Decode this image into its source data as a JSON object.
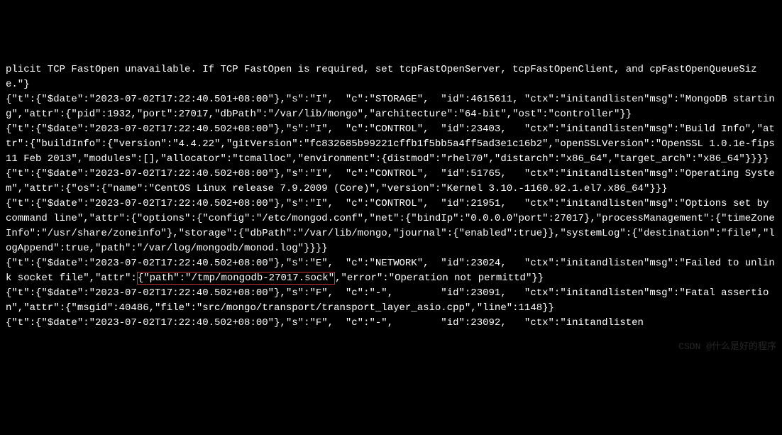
{
  "lines": {
    "line0": "plicit TCP FastOpen unavailable. If TCP FastOpen is required, set tcpFastOpenServer, tcpFastOpenClient, and cpFastOpenQueueSize.\"}",
    "line1": "{\"t\":{\"$date\":\"2023-07-02T17:22:40.501+08:00\"},\"s\":\"I\",  \"c\":\"STORAGE\",  \"id\":4615611, \"ctx\":\"initandlisten\"msg\":\"MongoDB starting\",\"attr\":{\"pid\":1932,\"port\":27017,\"dbPath\":\"/var/lib/mongo\",\"architecture\":\"64-bit\",\"ost\":\"controller\"}}",
    "line2": "{\"t\":{\"$date\":\"2023-07-02T17:22:40.502+08:00\"},\"s\":\"I\",  \"c\":\"CONTROL\",  \"id\":23403,   \"ctx\":\"initandlisten\"msg\":\"Build Info\",\"attr\":{\"buildInfo\":{\"version\":\"4.4.22\",\"gitVersion\":\"fc832685b99221cffb1f5bb5a4ff5ad3e1c16b2\",\"openSSLVersion\":\"OpenSSL 1.0.1e-fips 11 Feb 2013\",\"modules\":[],\"allocator\":\"tcmalloc\",\"environment\":{distmod\":\"rhel70\",\"distarch\":\"x86_64\",\"target_arch\":\"x86_64\"}}}}",
    "line3": "{\"t\":{\"$date\":\"2023-07-02T17:22:40.502+08:00\"},\"s\":\"I\",  \"c\":\"CONTROL\",  \"id\":51765,   \"ctx\":\"initandlisten\"msg\":\"Operating System\",\"attr\":{\"os\":{\"name\":\"CentOS Linux release 7.9.2009 (Core)\",\"version\":\"Kernel 3.10.-1160.92.1.el7.x86_64\"}}}",
    "line4": "{\"t\":{\"$date\":\"2023-07-02T17:22:40.502+08:00\"},\"s\":\"I\",  \"c\":\"CONTROL\",  \"id\":21951,   \"ctx\":\"initandlisten\"msg\":\"Options set by command line\",\"attr\":{\"options\":{\"config\":\"/etc/mongod.conf\",\"net\":{\"bindIp\":\"0.0.0.0\"port\":27017},\"processManagement\":{\"timeZoneInfo\":\"/usr/share/zoneinfo\"},\"storage\":{\"dbPath\":\"/var/lib/mongo,\"journal\":{\"enabled\":true}},\"systemLog\":{\"destination\":\"file\",\"logAppend\":true,\"path\":\"/var/log/mongodb/monod.log\"}}}}",
    "line5_pre": "{\"t\":{\"$date\":\"2023-07-02T17:22:40.502+08:00\"},\"s\":\"E\",  \"c\":\"NETWORK\",  \"id\":23024,   \"ctx\":\"initandlisten\"msg\":\"Failed to unlink socket file\",\"attr\":",
    "line5_hl": "{\"path\":\"/tmp/mongodb-27017.sock\"",
    "line5_post": ",\"error\":\"Operation not permittd\"}}",
    "line6": "{\"t\":{\"$date\":\"2023-07-02T17:22:40.502+08:00\"},\"s\":\"F\",  \"c\":\"-\",        \"id\":23091,   \"ctx\":\"initandlisten\"msg\":\"Fatal assertion\",\"attr\":{\"msgid\":40486,\"file\":\"src/mongo/transport/transport_layer_asio.cpp\",\"line\":1148}}",
    "line7": "{\"t\":{\"$date\":\"2023-07-02T17:22:40.502+08:00\"},\"s\":\"F\",  \"c\":\"-\",        \"id\":23092,   \"ctx\":\"initandlisten"
  },
  "watermark": "CSDN @什么是好的程序"
}
